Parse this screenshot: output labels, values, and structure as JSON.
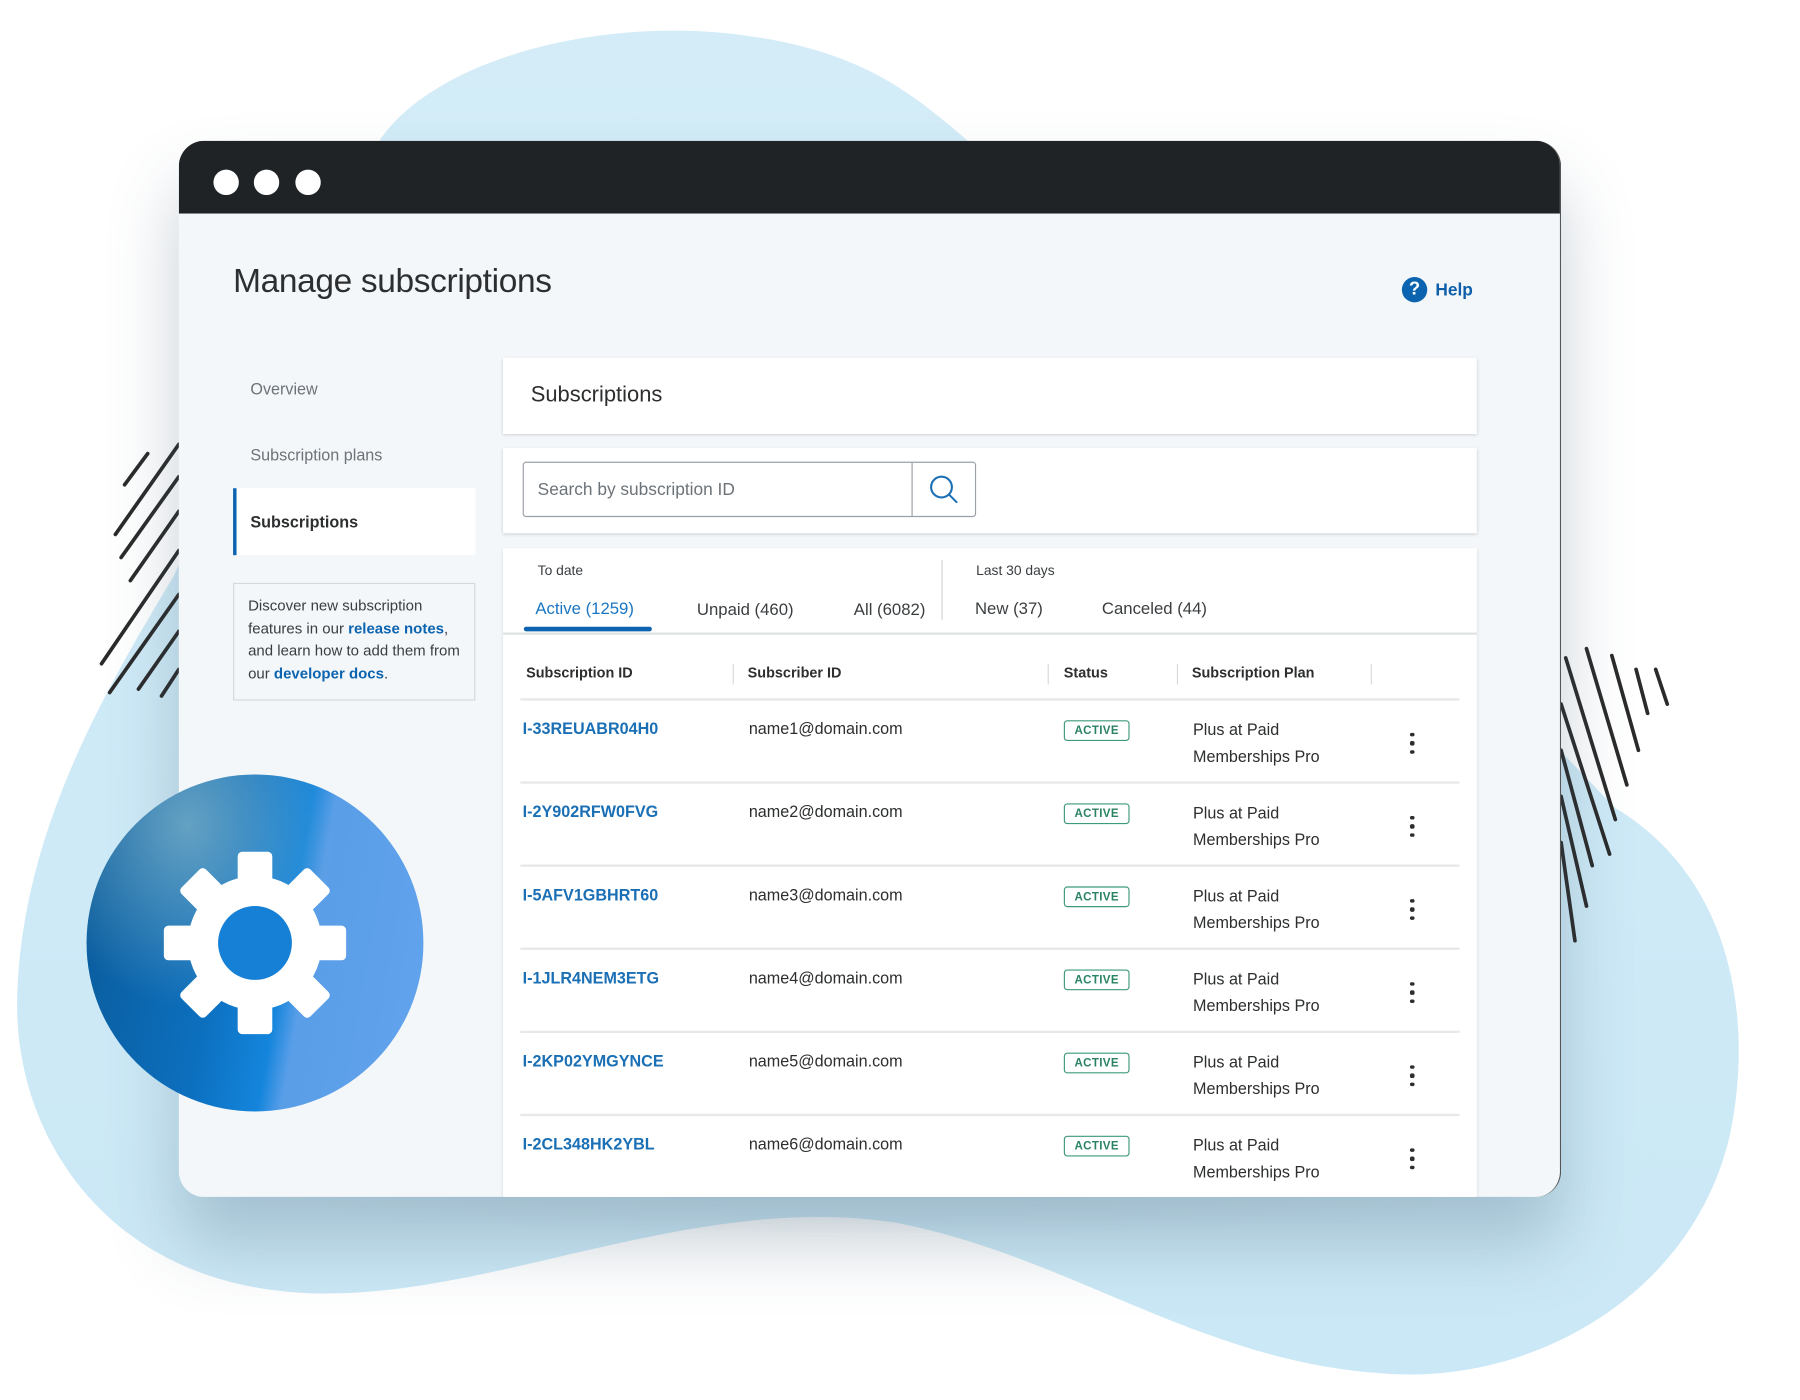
{
  "window": {
    "title_bar_dots": 3
  },
  "page": {
    "title": "Manage subscriptions",
    "help_label": "Help",
    "help_icon": "question-circle-icon"
  },
  "sidebar": {
    "items": [
      {
        "label": "Overview",
        "active": false
      },
      {
        "label": "Subscription plans",
        "active": false
      },
      {
        "label": "Subscriptions",
        "active": true
      }
    ],
    "info": {
      "text_1": "Discover new subscription features in our ",
      "link_1": "release notes",
      "text_2": ", and learn how to add them from our ",
      "link_2": "developer docs",
      "text_3": "."
    }
  },
  "main": {
    "card_title": "Subscriptions",
    "search": {
      "placeholder": "Search by subscription ID",
      "value": "",
      "icon": "search-icon"
    },
    "tab_groups": [
      {
        "label": "To date",
        "tabs": [
          {
            "label": "Active (1259)",
            "active": true
          },
          {
            "label": "Unpaid (460)",
            "active": false
          },
          {
            "label": "All (6082)",
            "active": false
          }
        ]
      },
      {
        "label": "Last 30 days",
        "tabs": [
          {
            "label": "New (37)",
            "active": false
          },
          {
            "label": "Canceled (44)",
            "active": false
          }
        ]
      }
    ],
    "table": {
      "columns": [
        "Subscription ID",
        "Subscriber ID",
        "Status",
        "Subscription Plan"
      ],
      "rows": [
        {
          "id": "I-33REUABR04H0",
          "subscriber": "name1@domain.com",
          "status": "ACTIVE",
          "plan_line1": "Plus at Paid",
          "plan_line2": "Memberships Pro"
        },
        {
          "id": "I-2Y902RFW0FVG",
          "subscriber": "name2@domain.com",
          "status": "ACTIVE",
          "plan_line1": "Plus at Paid",
          "plan_line2": "Memberships Pro"
        },
        {
          "id": "I-5AFV1GBHRT60",
          "subscriber": "name3@domain.com",
          "status": "ACTIVE",
          "plan_line1": "Plus at Paid",
          "plan_line2": "Memberships Pro"
        },
        {
          "id": "I-1JLR4NEM3ETG",
          "subscriber": "name4@domain.com",
          "status": "ACTIVE",
          "plan_line1": "Plus at Paid",
          "plan_line2": "Memberships Pro"
        },
        {
          "id": "I-2KP02YMGYNCE",
          "subscriber": "name5@domain.com",
          "status": "ACTIVE",
          "plan_line1": "Plus at Paid",
          "plan_line2": "Memberships Pro"
        },
        {
          "id": "I-2CL348HK2YBL",
          "subscriber": "name6@domain.com",
          "status": "ACTIVE",
          "plan_line1": "Plus at Paid",
          "plan_line2": "Memberships Pro"
        }
      ]
    }
  },
  "decoration": {
    "badge_icon": "gear-icon"
  },
  "colors": {
    "accent": "#0c64b0",
    "link": "#1a6fb5",
    "titlebar": "#1f2326",
    "status_active": "#2a8362",
    "blob": "#cfe9f6"
  }
}
